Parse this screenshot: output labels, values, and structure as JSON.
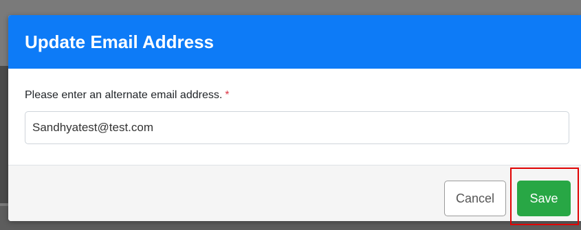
{
  "modal": {
    "title": "Update Email Address",
    "field_label": "Please enter an alternate email address.",
    "required_mark": "*",
    "email_value": "Sandhyatest@test.com",
    "cancel_label": "Cancel",
    "save_label": "Save"
  },
  "colors": {
    "header": "#0d7bf7",
    "save_button": "#28a745",
    "required": "#dc3545",
    "highlight": "#e00000"
  }
}
